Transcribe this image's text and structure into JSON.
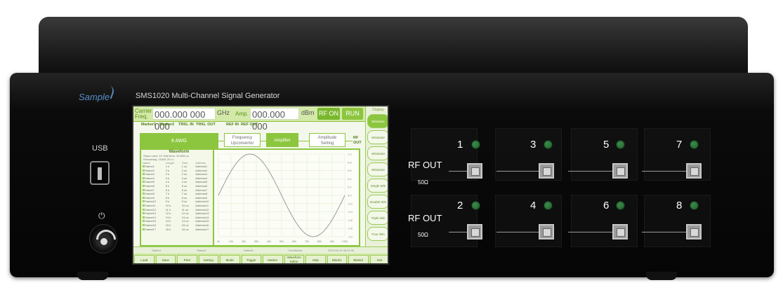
{
  "device": {
    "brand": "Sample",
    "model_title": "SMS1020 Multi-Channel Signal Generator",
    "usb_label": "USB",
    "power_symbol": "⏻"
  },
  "screen": {
    "top_bar": {
      "carrier_label": "Carrier\nFreq.",
      "freq_value": "000.000 000 000",
      "freq_unit": "GHz",
      "amp_label": "Amp.",
      "amp_value": "000.000 000",
      "amp_unit": "dBm",
      "rf_on_label": "RF ON",
      "run_label": "RUN"
    },
    "sidebar": {
      "title": "Display",
      "buttons": [
        "Window1",
        "Window2",
        "Window3",
        "Window4",
        "Single Win",
        "Double Win",
        "Triple Win",
        "Four Win"
      ]
    },
    "signal_chain": {
      "marker1": "Marker1",
      "marker2": "Marker2",
      "trig_in": "TRIG. IN",
      "trig_out": "TRIG. OUT",
      "ref_in": "REF IN",
      "ref_out": "REF OUT",
      "awg_block": "8 AWG",
      "upconverter_block": "Frequency\nUpconvertor",
      "amplifier_block": "Amplifier",
      "amplitude_block": "Amplitude\nSetting",
      "rf_out": "RF\nOUT"
    },
    "waveform_panel": {
      "title": "Waveform",
      "meta_1": "Steps used: 10        Total time: 20.805 us",
      "meta_2": "Remaining: 16348        20 Ls",
      "columns": [
        "Name",
        "Length",
        "Time",
        "Address"
      ],
      "rows": [
        [
          "Name1",
          "1 k",
          "1 us",
          "Address1"
        ],
        [
          "Name2",
          "2 k",
          "2 us",
          "Address2"
        ],
        [
          "Name3",
          "2 k",
          "2 us",
          "Address3"
        ],
        [
          "Name4",
          "3 k",
          "3 us",
          "Address4"
        ],
        [
          "Name5",
          "4 k",
          "4 us",
          "Address5"
        ],
        [
          "Name6",
          "5 k",
          "5 us",
          "Address6"
        ],
        [
          "Name7",
          "6 k",
          "6 us",
          "Address7"
        ],
        [
          "Name8",
          "7 k",
          "7 us",
          "Address8"
        ],
        [
          "Name9",
          "8 k",
          "8 us",
          "Address9"
        ],
        [
          "Name10",
          "9 k",
          "9 us",
          "Address10"
        ],
        [
          "Name11",
          "10 k",
          "10 us",
          "Address11"
        ],
        [
          "Name12",
          "11 k",
          "11 us",
          "Address12"
        ],
        [
          "Name13",
          "12 k",
          "12 us",
          "Address13"
        ],
        [
          "Name14",
          "13 k",
          "13 us",
          "Address14"
        ],
        [
          "Name15",
          "14 k",
          "14 us",
          "Address15"
        ],
        [
          "Name16",
          "15 k",
          "15 us",
          "Address16"
        ],
        [
          "Name17",
          "16 k",
          "16 us",
          "Address17"
        ]
      ]
    },
    "plot": {
      "x_ticks": [
        "0k",
        "10k",
        "20k",
        "30k",
        "40k",
        "50k",
        "60k",
        "70k",
        "80k",
        "90k",
        "100k"
      ],
      "y_ticks": [
        "1.0",
        "0.8",
        "0.6",
        "0.4",
        "0.2",
        "0.0",
        "-0.2",
        "-0.4",
        "-0.6",
        "-0.8",
        "-1.0"
      ]
    },
    "status_bar": {
      "cell1": "Status1",
      "cell2": "Status2",
      "cell3": "Status3",
      "cell4": "Conditional",
      "datetime": "2019-08-10  08:22:33"
    },
    "softkeys": [
      "Load",
      "Save",
      "Print",
      "Setting",
      "Mode",
      "Trigger",
      "Marker",
      "Waveform\nEditor",
      "Help",
      "Blank1",
      "Blank2",
      "Exit"
    ]
  },
  "rf_panel": {
    "rf_out_label": "RF OUT",
    "impedance": "50Ω",
    "channels_top": [
      "1",
      "3",
      "5",
      "7"
    ],
    "channels_bottom": [
      "2",
      "4",
      "6",
      "8"
    ],
    "led_color": "#2f7a3f"
  },
  "chart_data": {
    "type": "line",
    "title": "",
    "xlabel": "",
    "ylabel": "",
    "x": [
      0,
      10,
      20,
      30,
      40,
      50,
      60,
      70,
      80,
      90,
      100
    ],
    "series": [
      {
        "values": [
          0.0,
          0.59,
          0.95,
          0.95,
          0.59,
          0.0,
          -0.59,
          -0.95,
          -0.95,
          -0.59,
          0.0
        ]
      }
    ],
    "xlim": [
      0,
      100
    ],
    "ylim": [
      -1,
      1
    ],
    "grid": true
  }
}
